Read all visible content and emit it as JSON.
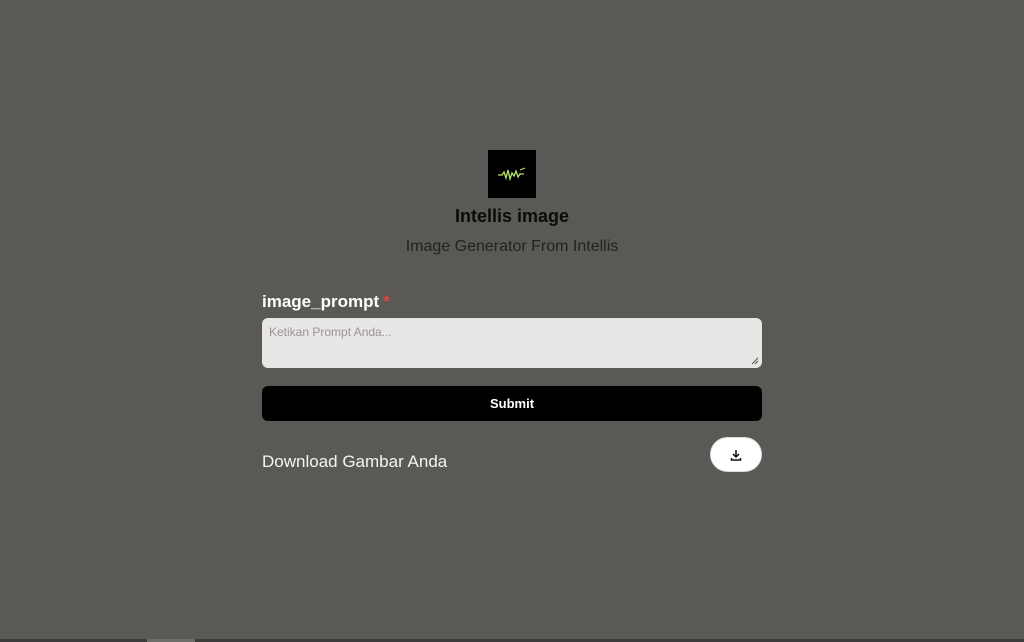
{
  "app": {
    "title": "Intellis image",
    "subtitle": "Image Generator From Intellis",
    "logo_icon": "intellis-logo-icon"
  },
  "form": {
    "field_label": "image_prompt",
    "required_mark": "*",
    "prompt_placeholder": "Ketikan Prompt Anda...",
    "prompt_value": "",
    "submit_label": "Submit"
  },
  "download": {
    "label": "Download Gambar Anda",
    "icon": "download-icon"
  },
  "colors": {
    "background": "#5a5955",
    "accent": "#000000",
    "required": "#e0453d"
  }
}
